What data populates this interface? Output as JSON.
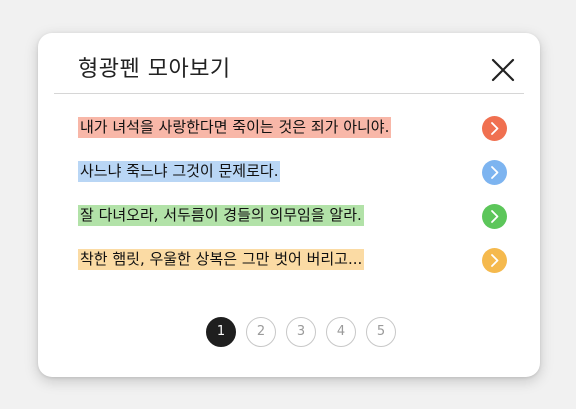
{
  "dialog": {
    "title": "형광펜 모아보기"
  },
  "quotes": [
    {
      "text": "내가 녀석을 사랑한다면 죽이는 것은 죄가 아니야.",
      "highlight": "#f8b7a8",
      "button_color": "#f07050"
    },
    {
      "text": "사느냐 죽느냐 그것이 문제로다.",
      "highlight": "#b9d6f5",
      "button_color": "#7db4f0"
    },
    {
      "text": "잘 다녀오라, 서두름이 경들의 의무임을 알라.",
      "highlight": "#b2e2a8",
      "button_color": "#5cc65a"
    },
    {
      "text": "착한 햄릿, 우울한 상복은 그만 벗어 버리고...",
      "highlight": "#fbdba4",
      "button_color": "#f5b94d"
    }
  ],
  "pagination": {
    "pages": [
      "1",
      "2",
      "3",
      "4",
      "5"
    ],
    "current": "1"
  },
  "icons": {
    "close": "close-icon",
    "go": "chevron-right-icon"
  }
}
